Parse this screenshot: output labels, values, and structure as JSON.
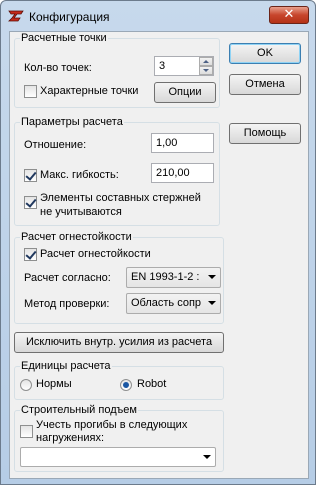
{
  "window": {
    "title": "Конфигурация",
    "close_glyph": "✕",
    "icon": "app-logo-icon",
    "accent": "#c7452c"
  },
  "calc_points": {
    "title": "Расчетные точки",
    "count_label": "Кол-во точек:",
    "count_value": "3",
    "characteristic_label": "Характерные точки",
    "characteristic_checked": false,
    "options_label": "Опции"
  },
  "dialog_buttons": {
    "ok_label": "OK",
    "cancel_label": "Отмена",
    "help_label": "Помощь"
  },
  "calc_params": {
    "title": "Параметры расчета",
    "ratio_label": "Отношение:",
    "ratio_value": "1,00",
    "max_slenderness_label": "Макс. гибкость:",
    "max_slenderness_value": "210,00",
    "max_slenderness_checked": true,
    "ignore_composite_label_1": "Элементы составных стержней",
    "ignore_composite_label_2": "не учитываются",
    "ignore_composite_checked": true
  },
  "fire": {
    "title": "Расчет огнестойкости",
    "enable_label": "Расчет огнестойкости",
    "enable_checked": true,
    "according_label": "Расчет согласно:",
    "according_value": "EN 1993-1-2 :",
    "method_label": "Метод проверки:",
    "method_value": "Область сопр"
  },
  "exclude_button_label": "Исключить внутр. усилия из расчета",
  "units": {
    "title": "Единицы расчета",
    "options": [
      {
        "label": "Нормы",
        "selected": false
      },
      {
        "label": "Robot",
        "selected": true
      }
    ]
  },
  "camber": {
    "title": "Строительный подъем",
    "deflection_label_1": "Учесть прогибы в следующих",
    "deflection_label_2": "нагружениях:",
    "deflection_checked": false,
    "loads_value": ""
  }
}
